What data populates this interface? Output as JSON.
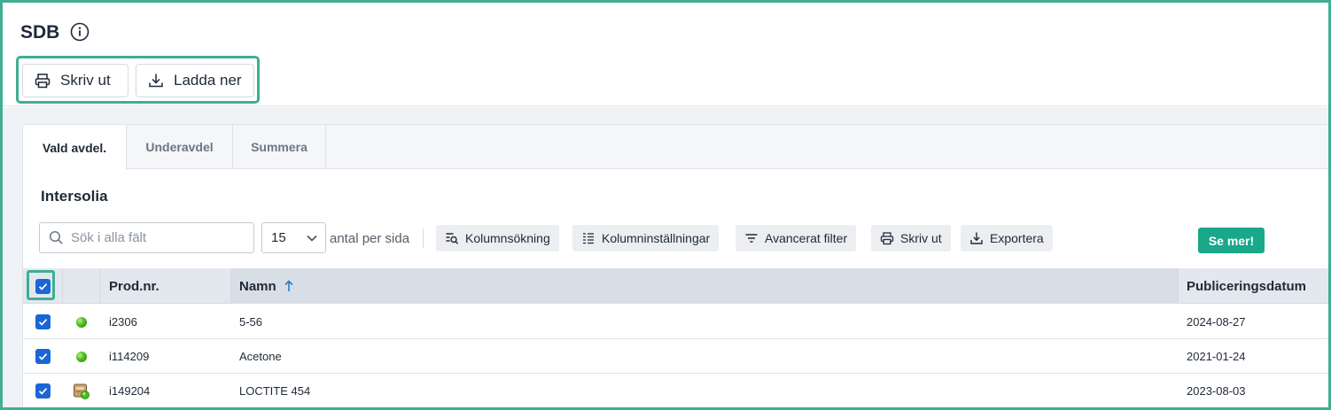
{
  "page": {
    "title": "SDB"
  },
  "top_actions": {
    "print_label": "Skriv ut",
    "download_label": "Ladda ner"
  },
  "tabs": [
    {
      "label": "Vald avdel.",
      "active": true
    },
    {
      "label": "Underavdel",
      "active": false
    },
    {
      "label": "Summera",
      "active": false
    }
  ],
  "section": {
    "title": "Intersolia"
  },
  "toolbar": {
    "search_placeholder": "Sök i alla fält",
    "per_page_value": "15",
    "per_page_label": "antal per sida",
    "column_search": "Kolumnsökning",
    "column_settings": "Kolumninställningar",
    "advanced_filter": "Avancerat filter",
    "print": "Skriv ut",
    "export": "Exportera",
    "see_more": "Se mer!"
  },
  "table": {
    "columns": [
      "Prod.nr.",
      "Namn",
      "Publiceringsdatum"
    ],
    "sort": {
      "column": "Namn",
      "direction": "ascending"
    },
    "header_checkbox_checked": true,
    "rows": [
      {
        "checked": true,
        "status_icon": "green-dot-icon",
        "prod_nr": "i2306",
        "name": "5-56",
        "published": "2024-08-27"
      },
      {
        "checked": true,
        "status_icon": "green-dot-icon",
        "prod_nr": "i114209",
        "name": "Acetone",
        "published": "2021-01-24"
      },
      {
        "checked": true,
        "status_icon": "package-green-icon",
        "prod_nr": "i149204",
        "name": "LOCTITE 454",
        "published": "2023-08-03"
      }
    ]
  },
  "colors": {
    "highlight": "#3fae93",
    "primary_button": "#19a889",
    "checkbox": "#1a66d6",
    "sort_arrow": "#2a7cc7"
  }
}
